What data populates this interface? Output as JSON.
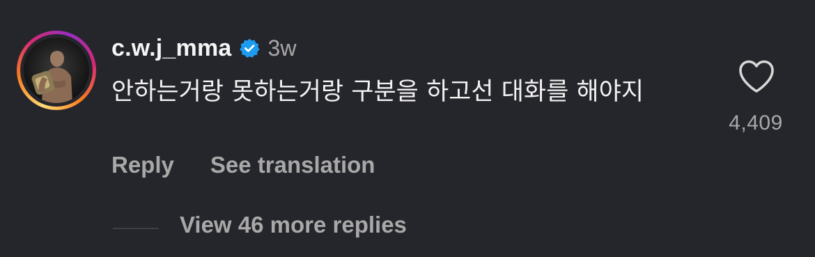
{
  "comment": {
    "username": "c.w.j_mma",
    "verified_icon": "verified-badge-icon",
    "timestamp": "3w",
    "text": "안하는거랑 못하는거랑 구분을 하고선 대화를 해야지",
    "likes": "4,409",
    "like_icon": "heart-outline-icon",
    "avatar_icon": "profile-photo"
  },
  "actions": {
    "reply_label": "Reply",
    "translate_label": "See translation"
  },
  "replies": {
    "view_more_label": "View 46 more replies"
  },
  "colors": {
    "background": "#25262c",
    "primary_text": "#f2f2f2",
    "secondary_text": "#a8a8a8",
    "verified_blue": "#1d9bf0"
  }
}
